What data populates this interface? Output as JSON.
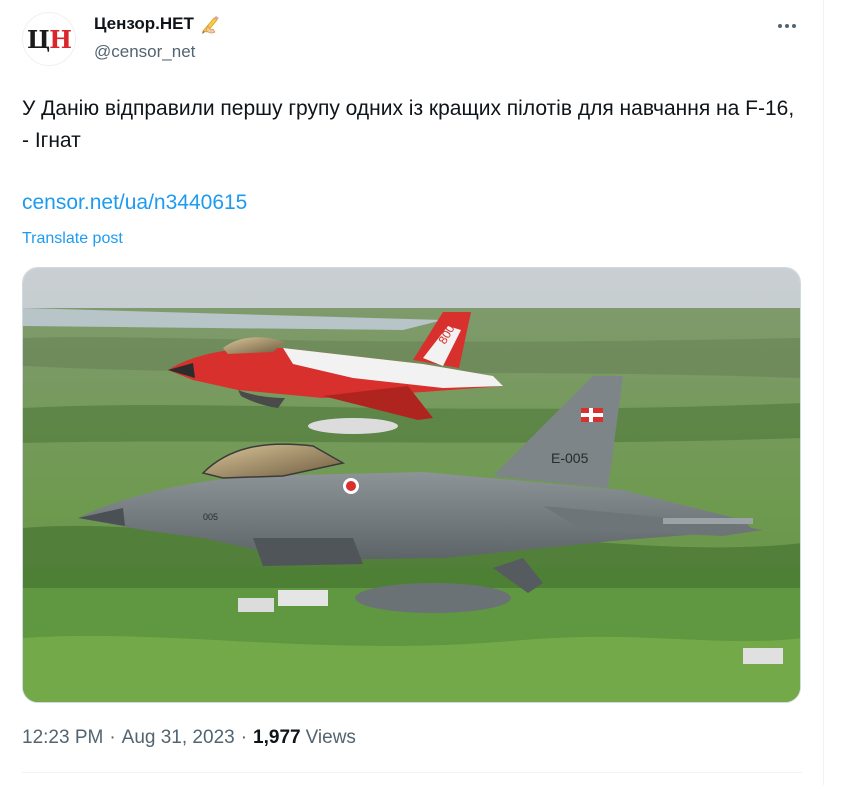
{
  "author": {
    "display_name": "Цензор.НЕТ",
    "handle": "@censor_net",
    "avatar_text_black": "Ц",
    "avatar_text_red": "Н",
    "badge_icon": "writing-hand-icon"
  },
  "post": {
    "text": "У Данію відправили першу групу одних із кращих пілотів для навчання на F-16, - Ігнат",
    "link": "censor.net/ua/n3440615",
    "translate_label": "Translate post",
    "media": {
      "description_icon": "photo",
      "aircraft_tail_front": "E-005",
      "aircraft_nose_front": "005",
      "aircraft_tail_back": "800"
    }
  },
  "meta": {
    "time": "12:23 PM",
    "separator": "·",
    "date": "Aug 31, 2023",
    "views_count": "1,977",
    "views_label": "Views"
  },
  "colors": {
    "link": "#1d9bf0",
    "secondary_text": "#536471",
    "primary_text": "#0f1419",
    "avatar_red": "#d9252b"
  }
}
